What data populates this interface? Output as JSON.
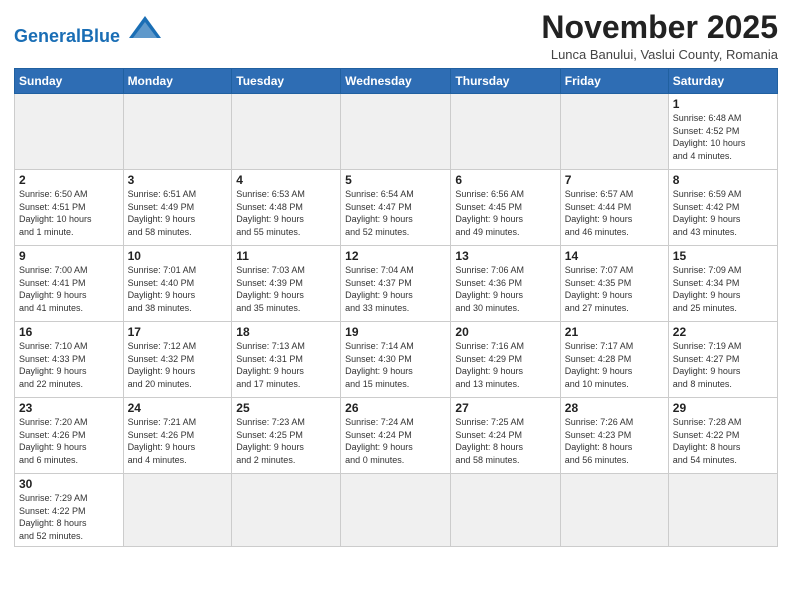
{
  "header": {
    "logo_general": "General",
    "logo_blue": "Blue",
    "month": "November 2025",
    "location": "Lunca Banului, Vaslui County, Romania"
  },
  "weekdays": [
    "Sunday",
    "Monday",
    "Tuesday",
    "Wednesday",
    "Thursday",
    "Friday",
    "Saturday"
  ],
  "weeks": [
    [
      {
        "day": "",
        "info": "",
        "empty": true
      },
      {
        "day": "",
        "info": "",
        "empty": true
      },
      {
        "day": "",
        "info": "",
        "empty": true
      },
      {
        "day": "",
        "info": "",
        "empty": true
      },
      {
        "day": "",
        "info": "",
        "empty": true
      },
      {
        "day": "",
        "info": "",
        "empty": true
      },
      {
        "day": "1",
        "info": "Sunrise: 6:48 AM\nSunset: 4:52 PM\nDaylight: 10 hours\nand 4 minutes."
      }
    ],
    [
      {
        "day": "2",
        "info": "Sunrise: 6:50 AM\nSunset: 4:51 PM\nDaylight: 10 hours\nand 1 minute."
      },
      {
        "day": "3",
        "info": "Sunrise: 6:51 AM\nSunset: 4:49 PM\nDaylight: 9 hours\nand 58 minutes."
      },
      {
        "day": "4",
        "info": "Sunrise: 6:53 AM\nSunset: 4:48 PM\nDaylight: 9 hours\nand 55 minutes."
      },
      {
        "day": "5",
        "info": "Sunrise: 6:54 AM\nSunset: 4:47 PM\nDaylight: 9 hours\nand 52 minutes."
      },
      {
        "day": "6",
        "info": "Sunrise: 6:56 AM\nSunset: 4:45 PM\nDaylight: 9 hours\nand 49 minutes."
      },
      {
        "day": "7",
        "info": "Sunrise: 6:57 AM\nSunset: 4:44 PM\nDaylight: 9 hours\nand 46 minutes."
      },
      {
        "day": "8",
        "info": "Sunrise: 6:59 AM\nSunset: 4:42 PM\nDaylight: 9 hours\nand 43 minutes."
      }
    ],
    [
      {
        "day": "9",
        "info": "Sunrise: 7:00 AM\nSunset: 4:41 PM\nDaylight: 9 hours\nand 41 minutes."
      },
      {
        "day": "10",
        "info": "Sunrise: 7:01 AM\nSunset: 4:40 PM\nDaylight: 9 hours\nand 38 minutes."
      },
      {
        "day": "11",
        "info": "Sunrise: 7:03 AM\nSunset: 4:39 PM\nDaylight: 9 hours\nand 35 minutes."
      },
      {
        "day": "12",
        "info": "Sunrise: 7:04 AM\nSunset: 4:37 PM\nDaylight: 9 hours\nand 33 minutes."
      },
      {
        "day": "13",
        "info": "Sunrise: 7:06 AM\nSunset: 4:36 PM\nDaylight: 9 hours\nand 30 minutes."
      },
      {
        "day": "14",
        "info": "Sunrise: 7:07 AM\nSunset: 4:35 PM\nDaylight: 9 hours\nand 27 minutes."
      },
      {
        "day": "15",
        "info": "Sunrise: 7:09 AM\nSunset: 4:34 PM\nDaylight: 9 hours\nand 25 minutes."
      }
    ],
    [
      {
        "day": "16",
        "info": "Sunrise: 7:10 AM\nSunset: 4:33 PM\nDaylight: 9 hours\nand 22 minutes."
      },
      {
        "day": "17",
        "info": "Sunrise: 7:12 AM\nSunset: 4:32 PM\nDaylight: 9 hours\nand 20 minutes."
      },
      {
        "day": "18",
        "info": "Sunrise: 7:13 AM\nSunset: 4:31 PM\nDaylight: 9 hours\nand 17 minutes."
      },
      {
        "day": "19",
        "info": "Sunrise: 7:14 AM\nSunset: 4:30 PM\nDaylight: 9 hours\nand 15 minutes."
      },
      {
        "day": "20",
        "info": "Sunrise: 7:16 AM\nSunset: 4:29 PM\nDaylight: 9 hours\nand 13 minutes."
      },
      {
        "day": "21",
        "info": "Sunrise: 7:17 AM\nSunset: 4:28 PM\nDaylight: 9 hours\nand 10 minutes."
      },
      {
        "day": "22",
        "info": "Sunrise: 7:19 AM\nSunset: 4:27 PM\nDaylight: 9 hours\nand 8 minutes."
      }
    ],
    [
      {
        "day": "23",
        "info": "Sunrise: 7:20 AM\nSunset: 4:26 PM\nDaylight: 9 hours\nand 6 minutes."
      },
      {
        "day": "24",
        "info": "Sunrise: 7:21 AM\nSunset: 4:26 PM\nDaylight: 9 hours\nand 4 minutes."
      },
      {
        "day": "25",
        "info": "Sunrise: 7:23 AM\nSunset: 4:25 PM\nDaylight: 9 hours\nand 2 minutes."
      },
      {
        "day": "26",
        "info": "Sunrise: 7:24 AM\nSunset: 4:24 PM\nDaylight: 9 hours\nand 0 minutes."
      },
      {
        "day": "27",
        "info": "Sunrise: 7:25 AM\nSunset: 4:24 PM\nDaylight: 8 hours\nand 58 minutes."
      },
      {
        "day": "28",
        "info": "Sunrise: 7:26 AM\nSunset: 4:23 PM\nDaylight: 8 hours\nand 56 minutes."
      },
      {
        "day": "29",
        "info": "Sunrise: 7:28 AM\nSunset: 4:22 PM\nDaylight: 8 hours\nand 54 minutes."
      }
    ],
    [
      {
        "day": "30",
        "info": "Sunrise: 7:29 AM\nSunset: 4:22 PM\nDaylight: 8 hours\nand 52 minutes.",
        "lastrow": true
      },
      {
        "day": "",
        "info": "",
        "empty": true,
        "lastrow": true
      },
      {
        "day": "",
        "info": "",
        "empty": true,
        "lastrow": true
      },
      {
        "day": "",
        "info": "",
        "empty": true,
        "lastrow": true
      },
      {
        "day": "",
        "info": "",
        "empty": true,
        "lastrow": true
      },
      {
        "day": "",
        "info": "",
        "empty": true,
        "lastrow": true
      },
      {
        "day": "",
        "info": "",
        "empty": true,
        "lastrow": true
      }
    ]
  ]
}
